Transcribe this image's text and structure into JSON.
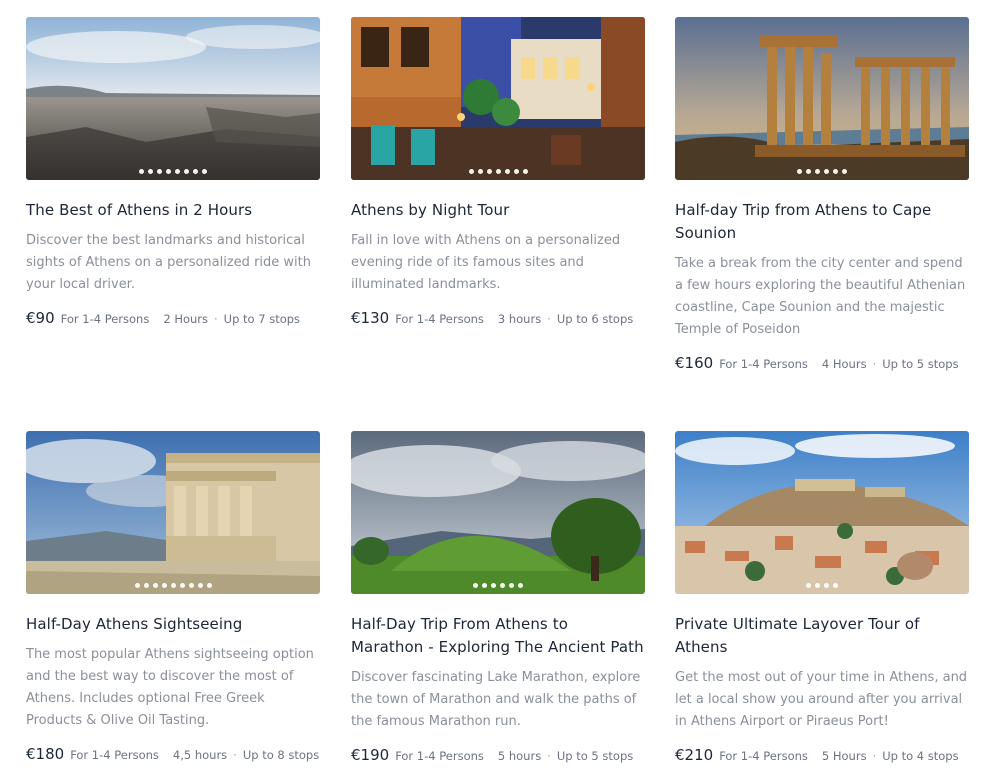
{
  "tours": [
    {
      "title": "The Best of Athens in 2 Hours",
      "description": "Discover the best landmarks and historical sights of Athens on a personalized ride with your local driver.",
      "price": "€90",
      "persons": "For 1-4 Persons",
      "duration": "2 Hours",
      "separator": "·",
      "stops": "Up to 7 stops",
      "image": "athens-city-panorama",
      "dot_count": 8
    },
    {
      "title": "Athens by Night Tour",
      "description": "Fall in love with Athens on a personalized evening ride of its famous sites and illuminated landmarks.",
      "price": "€130",
      "persons": "For 1-4 Persons",
      "duration": "3 hours",
      "separator": "·",
      "stops": "Up to 6 stops",
      "image": "night-street-cafe",
      "dot_count": 7
    },
    {
      "title": "Half-day Trip from Athens to Cape Sounion",
      "description": "Take a break from the city center and spend a few hours exploring the beautiful Athenian coastline, Cape Sounion and the majestic Temple of Poseidon",
      "price": "€160",
      "persons": "For 1-4 Persons",
      "duration": "4 Hours",
      "separator": "·",
      "stops": "Up to 5 stops",
      "image": "temple-of-poseidon-sunset",
      "dot_count": 6
    },
    {
      "title": "Half-Day Athens Sightseeing",
      "description": "The most popular Athens sightseeing option and the best way to discover the most of Athens. Includes optional Free Greek Products & Olive Oil Tasting.",
      "price": "€180",
      "persons": "For 1-4 Persons",
      "duration": "4,5 hours",
      "separator": "·",
      "stops": "Up to 8 stops",
      "image": "erechtheion-caryatids",
      "dot_count": 9
    },
    {
      "title": "Half-Day Trip From Athens to Marathon - Exploring The Ancient Path",
      "description": "Discover fascinating Lake Marathon, explore the town of Marathon and walk the paths of the famous Marathon run.",
      "price": "€190",
      "persons": "For 1-4 Persons",
      "duration": "5 hours",
      "separator": "·",
      "stops": "Up to 5 stops",
      "image": "marathon-tumulus-hill",
      "dot_count": 6
    },
    {
      "title": "Private Ultimate Layover Tour of Athens",
      "description": "Get the most out of your time in Athens, and let a local show you around after you arrival in Athens Airport or Piraeus Port!",
      "price": "€210",
      "persons": "For 1-4 Persons",
      "duration": "5 Hours",
      "separator": "·",
      "stops": "Up to 4 stops",
      "image": "acropolis-city-view",
      "dot_count": 4
    }
  ]
}
